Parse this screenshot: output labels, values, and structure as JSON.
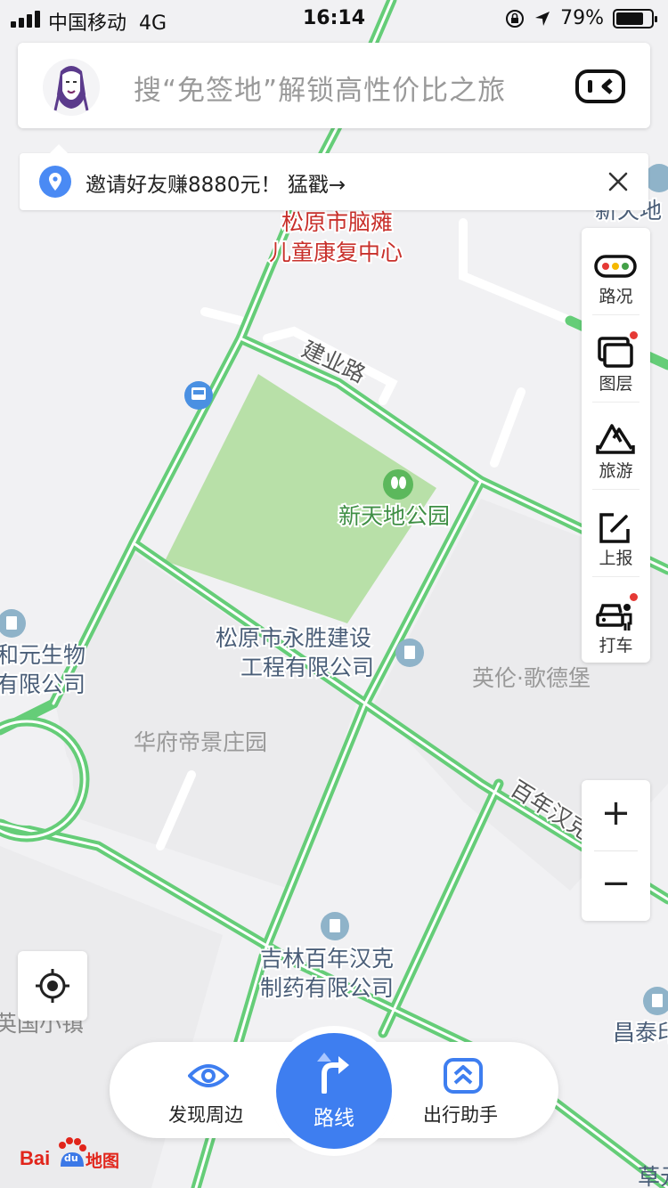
{
  "status_bar": {
    "carrier": "中国移动",
    "network": "4G",
    "time": "16:14",
    "battery_pct": "79%",
    "battery_level": 0.79
  },
  "search": {
    "placeholder": "搜“免签地”解锁高性价比之旅"
  },
  "invite_banner": {
    "text": "邀请好友赚8880元！ 猛戳→"
  },
  "toolbar": {
    "items": [
      {
        "label": "路况",
        "icon": "traffic-light-icon",
        "dot": false
      },
      {
        "label": "图层",
        "icon": "layers-icon",
        "dot": true
      },
      {
        "label": "旅游",
        "icon": "travel-icon",
        "dot": false
      },
      {
        "label": "上报",
        "icon": "report-icon",
        "dot": false
      },
      {
        "label": "打车",
        "icon": "taxi-icon",
        "dot": true
      }
    ]
  },
  "zoom": {
    "in_label": "+",
    "out_label": "−"
  },
  "bottom_nav": {
    "discover": "发现周边",
    "route": "路线",
    "assistant": "出行助手"
  },
  "logo": {
    "bai": "Bai",
    "du": "du",
    "ditu": "地图"
  },
  "map_labels": {
    "poi_hospital_1": "松原市脑瘫",
    "poi_hospital_2": "儿童康复中心",
    "road_jianye": "建业路",
    "park": "新天地公园",
    "company_yongsheng_1": "松原市永胜建设",
    "company_yongsheng_2": "工程有限公司",
    "yinglun": "英伦·歌德堡",
    "huafu": "华府帝景庄园",
    "bio_1": "和元生物",
    "bio_2": "有限公司",
    "road_bainian": "百年汉克",
    "pharma_1": "吉林百年汉克",
    "pharma_2": "制药有限公司",
    "xintiandi": "新天地",
    "changtai": "昌泰印",
    "yingyuan": "英国小镇",
    "bottom_right": "草元"
  },
  "colors": {
    "accent": "#3e7ef0",
    "road_green": "#65cd78",
    "park_fill": "#b8e0a8",
    "map_bg": "#f1f1f3",
    "poi_red": "#c8302b",
    "poi_blue_gray": "#4a5e78"
  }
}
